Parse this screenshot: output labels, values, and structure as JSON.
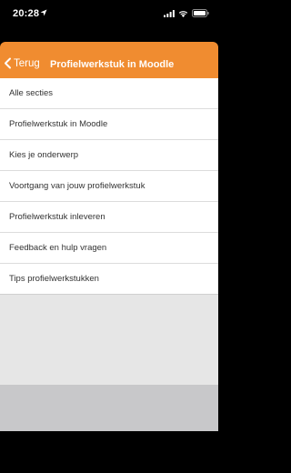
{
  "status_bar": {
    "time": "20:28"
  },
  "header": {
    "back_label": "Terug",
    "title": "Profielwerkstuk in Moodle",
    "color": "#f08c30"
  },
  "menu": {
    "items": [
      {
        "label": "Alle secties"
      },
      {
        "label": "Profielwerkstuk in Moodle"
      },
      {
        "label": "Kies je onderwerp"
      },
      {
        "label": "Voortgang van jouw profielwerkstuk"
      },
      {
        "label": "Profielwerkstuk inleveren"
      },
      {
        "label": "Feedback en hulp vragen"
      },
      {
        "label": "Tips profielwerkstukken"
      }
    ]
  },
  "icons": {
    "location": "location-arrow-icon",
    "signal": "cellular-signal-icon",
    "wifi": "wifi-icon",
    "battery": "battery-icon",
    "back": "chevron-left-icon"
  }
}
